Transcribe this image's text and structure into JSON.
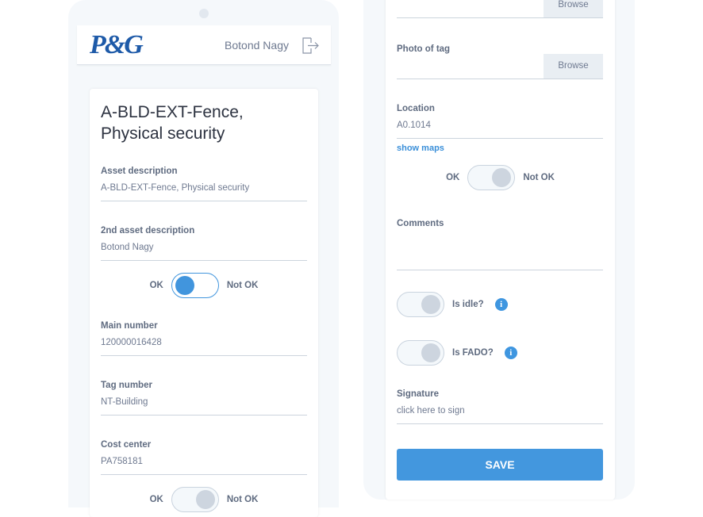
{
  "header": {
    "logo": "P&G",
    "user": "Botond Nagy"
  },
  "left": {
    "title": "A-BLD-EXT-Fence, Physical security",
    "fields": [
      {
        "label": "Asset description",
        "value": "A-BLD-EXT-Fence, Physical security"
      },
      {
        "label": "2nd asset description",
        "value": "Botond Nagy"
      },
      {
        "label": "Main number",
        "value": "120000016428"
      },
      {
        "label": "Tag number",
        "value": "NT-Building"
      },
      {
        "label": "Cost center",
        "value": "PA758181"
      }
    ],
    "toggle1": {
      "ok": "OK",
      "not_ok": "Not OK",
      "state": "OK"
    },
    "toggle2": {
      "ok": "OK",
      "not_ok": "Not OK",
      "state": "Not OK"
    }
  },
  "right": {
    "browse": "Browse",
    "photo": {
      "label": "Photo of tag",
      "button": "Browse"
    },
    "location": {
      "label": "Location",
      "value": "A0.1014",
      "link": "show maps"
    },
    "toggle": {
      "ok": "OK",
      "not_ok": "Not OK",
      "state": "Not OK"
    },
    "comments": {
      "label": "Comments",
      "value": ""
    },
    "idle": {
      "label": "Is idle?",
      "info": "i"
    },
    "fado": {
      "label": "Is FADO?",
      "info": "i"
    },
    "signature": {
      "label": "Signature",
      "placeholder": "click here to sign"
    },
    "save": "SAVE"
  },
  "colors": {
    "accent": "#4397de",
    "brand": "#1e5aa8"
  }
}
